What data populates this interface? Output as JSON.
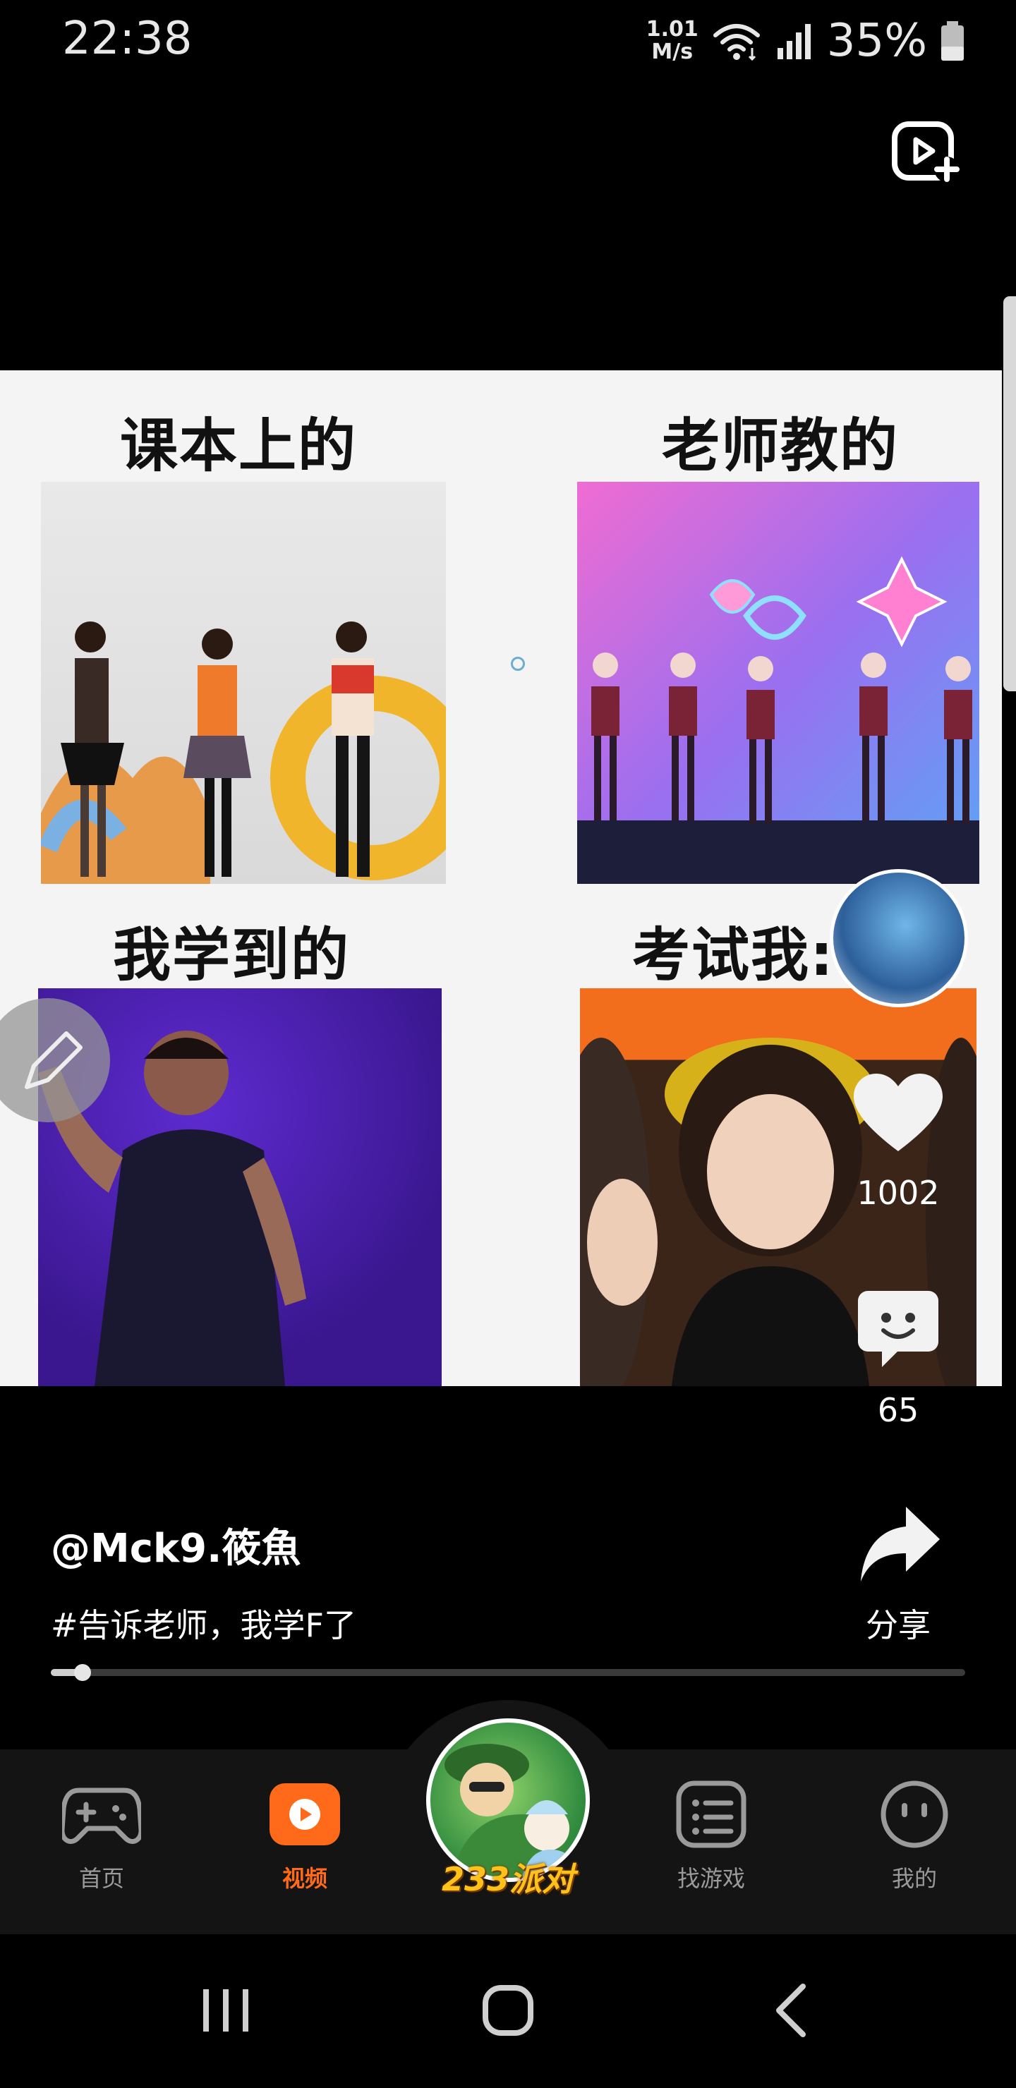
{
  "status_bar": {
    "time": "22:38",
    "net_speed_top": "1.01",
    "net_speed_bottom": "M/s",
    "battery": "35%",
    "icons": [
      "wifi-icon",
      "signal-icon",
      "battery-icon"
    ]
  },
  "header": {
    "upload_icon": "video-add-icon"
  },
  "video": {
    "captions": [
      "课本上的",
      "老师教的",
      "我学到的",
      "考试我:"
    ],
    "author": "@Mck9.筱魚",
    "description": "#告诉老师，我学F了",
    "progress": 0.035
  },
  "actions": {
    "like_count": "1002",
    "comment_count": "65",
    "share_label": "分享"
  },
  "tabs": [
    {
      "label": "首页",
      "icon": "gamepad-icon",
      "active": false
    },
    {
      "label": "视频",
      "icon": "play-icon",
      "active": true
    },
    {
      "label": "找游戏",
      "icon": "list-icon",
      "active": false
    },
    {
      "label": "我的",
      "icon": "face-icon",
      "active": false
    }
  ],
  "center_tab": {
    "label": "233派对"
  },
  "colors": {
    "accent": "#ff6a1a",
    "center_label": "#ffc21a",
    "background": "#000000"
  }
}
